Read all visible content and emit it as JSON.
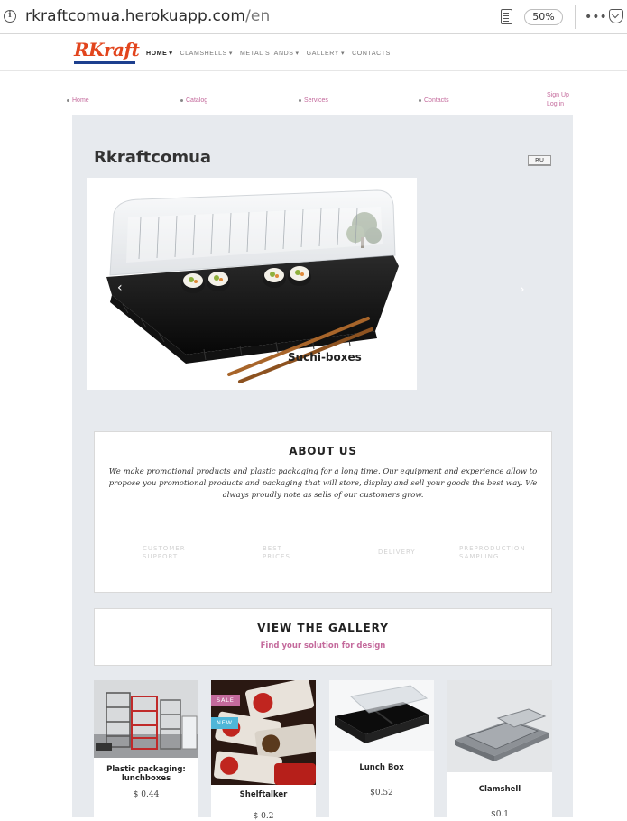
{
  "browser": {
    "url_host": "rkraftcomua.herokuapp.com",
    "url_path": "/en",
    "zoom": "50%",
    "menu_dots": "•••"
  },
  "header": {
    "logo_text": "RKraft",
    "nav": [
      {
        "label": "HOME",
        "active": true
      },
      {
        "label": "CLAMSHELLS"
      },
      {
        "label": "METAL STANDS"
      },
      {
        "label": "GALLERY"
      },
      {
        "label": "CONTACTS"
      }
    ]
  },
  "subnav": {
    "links": [
      "Home",
      "Catalog",
      "Services",
      "Contacts"
    ],
    "signup": "Sign Up",
    "login": "Log in"
  },
  "main": {
    "title": "Rkraftcomua",
    "lang_button": "RU",
    "slider": {
      "caption": "Suchi-boxes",
      "prev_arrow": "‹",
      "next_arrow": "›"
    },
    "about": {
      "title": "ABOUT US",
      "text": "We make promotional products and plastic packaging for a long time. Our equipment and experience allow to propose you promotional products and packaging that will store, display and sell your goods the best way. We always proudly note as sells of our customers grow.",
      "features": [
        [
          "CUSTOMER",
          "SUPPORT"
        ],
        [
          "BEST",
          "PRICES"
        ],
        [
          "DELIVERY"
        ],
        [
          "PREPRODUCTION",
          "SAMPLING"
        ]
      ]
    },
    "gallery": {
      "title": "VIEW THE GALLERY",
      "subtitle": "Find your solution for design"
    },
    "products": [
      {
        "name": "Plastic packaging: lunchboxes",
        "price": "$ 0.44"
      },
      {
        "name": "Shelftalker",
        "price": "$ 0.2",
        "badges": [
          "SALE",
          "NEW"
        ]
      },
      {
        "name": "Lunch Box",
        "price": "$0.52"
      },
      {
        "name": "Clamshell",
        "price": "$0.1"
      }
    ]
  },
  "colors": {
    "accent_pink": "#c46a9c",
    "logo_red": "#e2451d",
    "logo_blue": "#1d3f8e",
    "panel_bg": "#e7eaee",
    "badge_sale": "#c46a9c",
    "badge_new": "#4fb6d8"
  }
}
